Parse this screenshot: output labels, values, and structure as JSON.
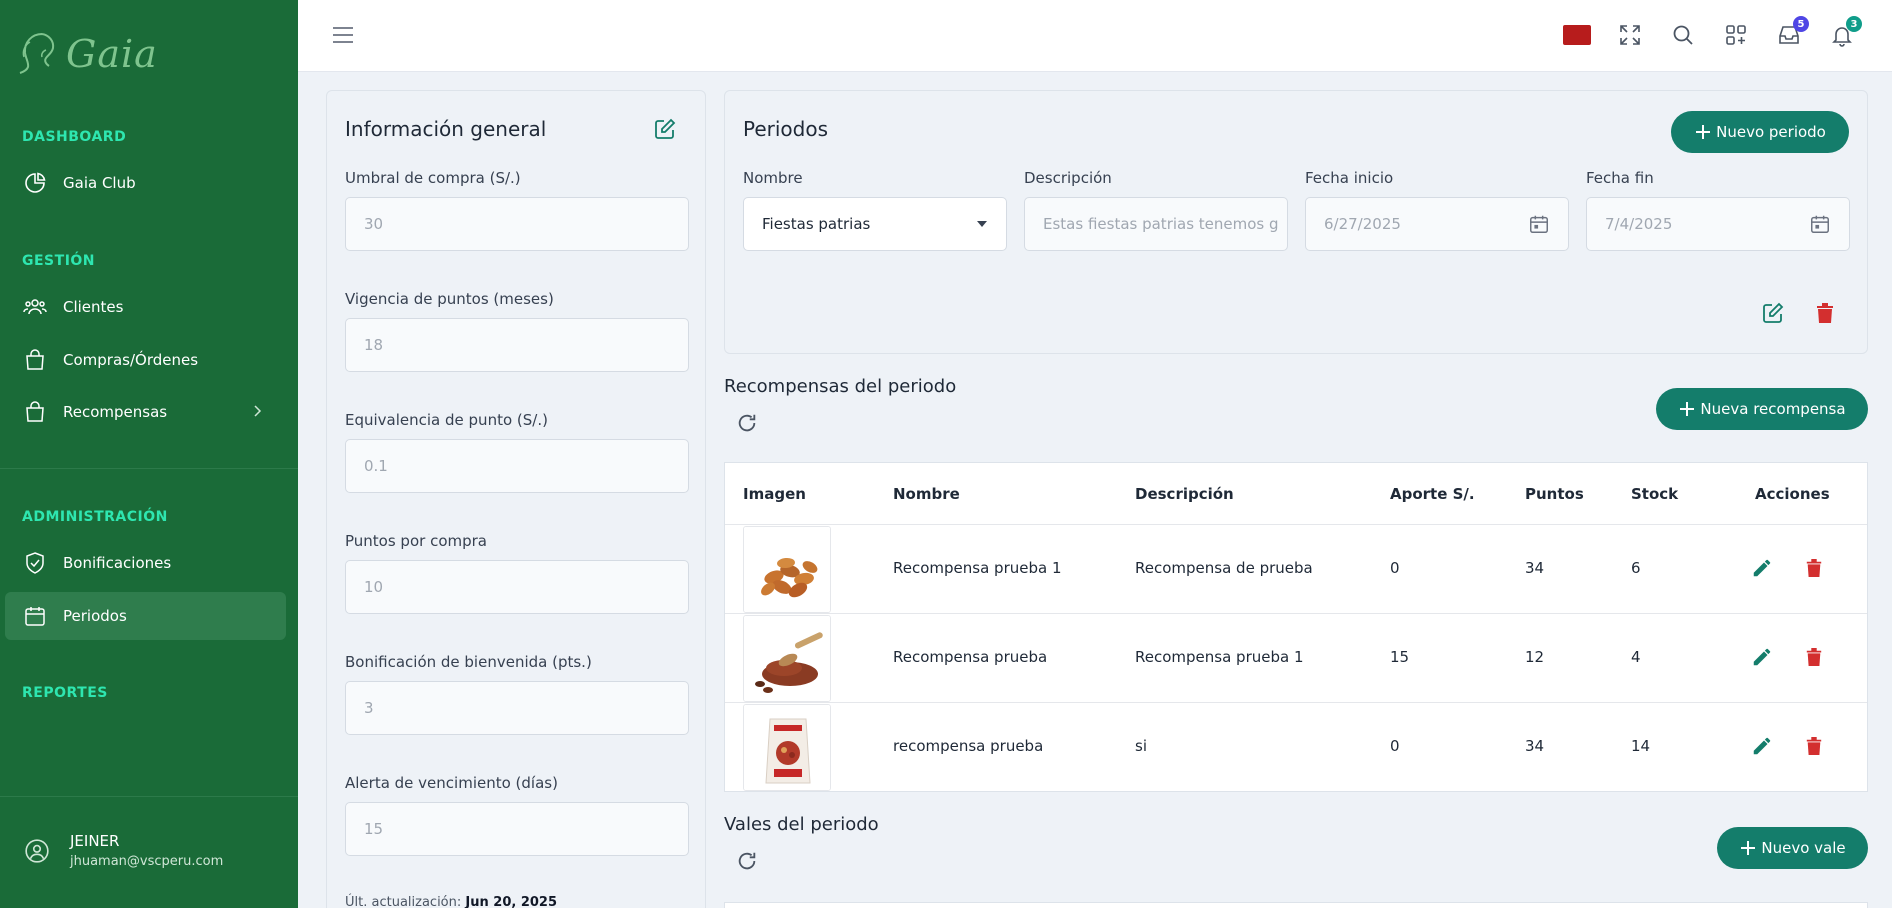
{
  "brand": {
    "name": "Gaia"
  },
  "sidebar": {
    "sections": [
      "DASHBOARD",
      "GESTIÓN",
      "ADMINISTRACIÓN",
      "REPORTES"
    ],
    "items": [
      {
        "label": "Gaia Club",
        "icon": "chart-pie-icon"
      },
      {
        "label": "Clientes",
        "icon": "users-icon"
      },
      {
        "label": "Compras/Órdenes",
        "icon": "shopping-bag-icon"
      },
      {
        "label": "Recompensas",
        "icon": "shopping-bag-icon"
      },
      {
        "label": "Bonificaciones",
        "icon": "shield-check-icon"
      },
      {
        "label": "Periodos",
        "icon": "calendar-icon"
      }
    ],
    "user": {
      "name": "JEINER",
      "email": "jhuaman@vscperu.com"
    }
  },
  "topbar": {
    "inbox_badge": "5",
    "notifications_badge": "3",
    "flag_color": "#b71c1c"
  },
  "info": {
    "title": "Información general",
    "fields": [
      {
        "label": "Umbral de compra (S/.)",
        "value": "30"
      },
      {
        "label": "Vigencia de puntos (meses)",
        "value": "18"
      },
      {
        "label": "Equivalencia de punto (S/.)",
        "value": "0.1"
      },
      {
        "label": "Puntos por compra",
        "value": "10"
      },
      {
        "label": "Bonificación de bienvenida (pts.)",
        "value": "3"
      },
      {
        "label": "Alerta de vencimiento (días)",
        "value": "15"
      }
    ],
    "last_update_label": "Últ. actualización:",
    "last_update_value": "Jun 20, 2025"
  },
  "periodos": {
    "title": "Periodos",
    "new_button": "Nuevo periodo",
    "labels": {
      "nombre": "Nombre",
      "descripcion": "Descripción",
      "inicio": "Fecha inicio",
      "fin": "Fecha fin"
    },
    "values": {
      "nombre": "Fiestas patrias",
      "descripcion": "Estas fiestas patrias tenemos g",
      "inicio": "6/27/2025",
      "fin": "7/4/2025"
    }
  },
  "recompensas": {
    "title": "Recompensas del periodo",
    "new_button": "Nueva recompensa",
    "columns": [
      "Imagen",
      "Nombre",
      "Descripción",
      "Aporte S/.",
      "Puntos",
      "Stock",
      "Acciones"
    ],
    "rows": [
      {
        "nombre": "Recompensa prueba 1",
        "descripcion": "Recompensa de prueba",
        "aporte": "0",
        "puntos": "34",
        "stock": "6",
        "image": "almonds"
      },
      {
        "nombre": "Recompensa prueba",
        "descripcion": "Recompensa prueba 1",
        "aporte": "15",
        "puntos": "12",
        "stock": "4",
        "image": "cacao-powder"
      },
      {
        "nombre": "recompensa prueba",
        "descripcion": "si",
        "aporte": "0",
        "puntos": "34",
        "stock": "14",
        "image": "product-bag"
      }
    ]
  },
  "vales": {
    "title": "Vales del periodo",
    "new_button": "Nuevo vale"
  },
  "colors": {
    "sidebar": "#1a6b38",
    "accent": "#147d6b",
    "danger": "#d32f2f",
    "section": "#2ee6b0"
  }
}
